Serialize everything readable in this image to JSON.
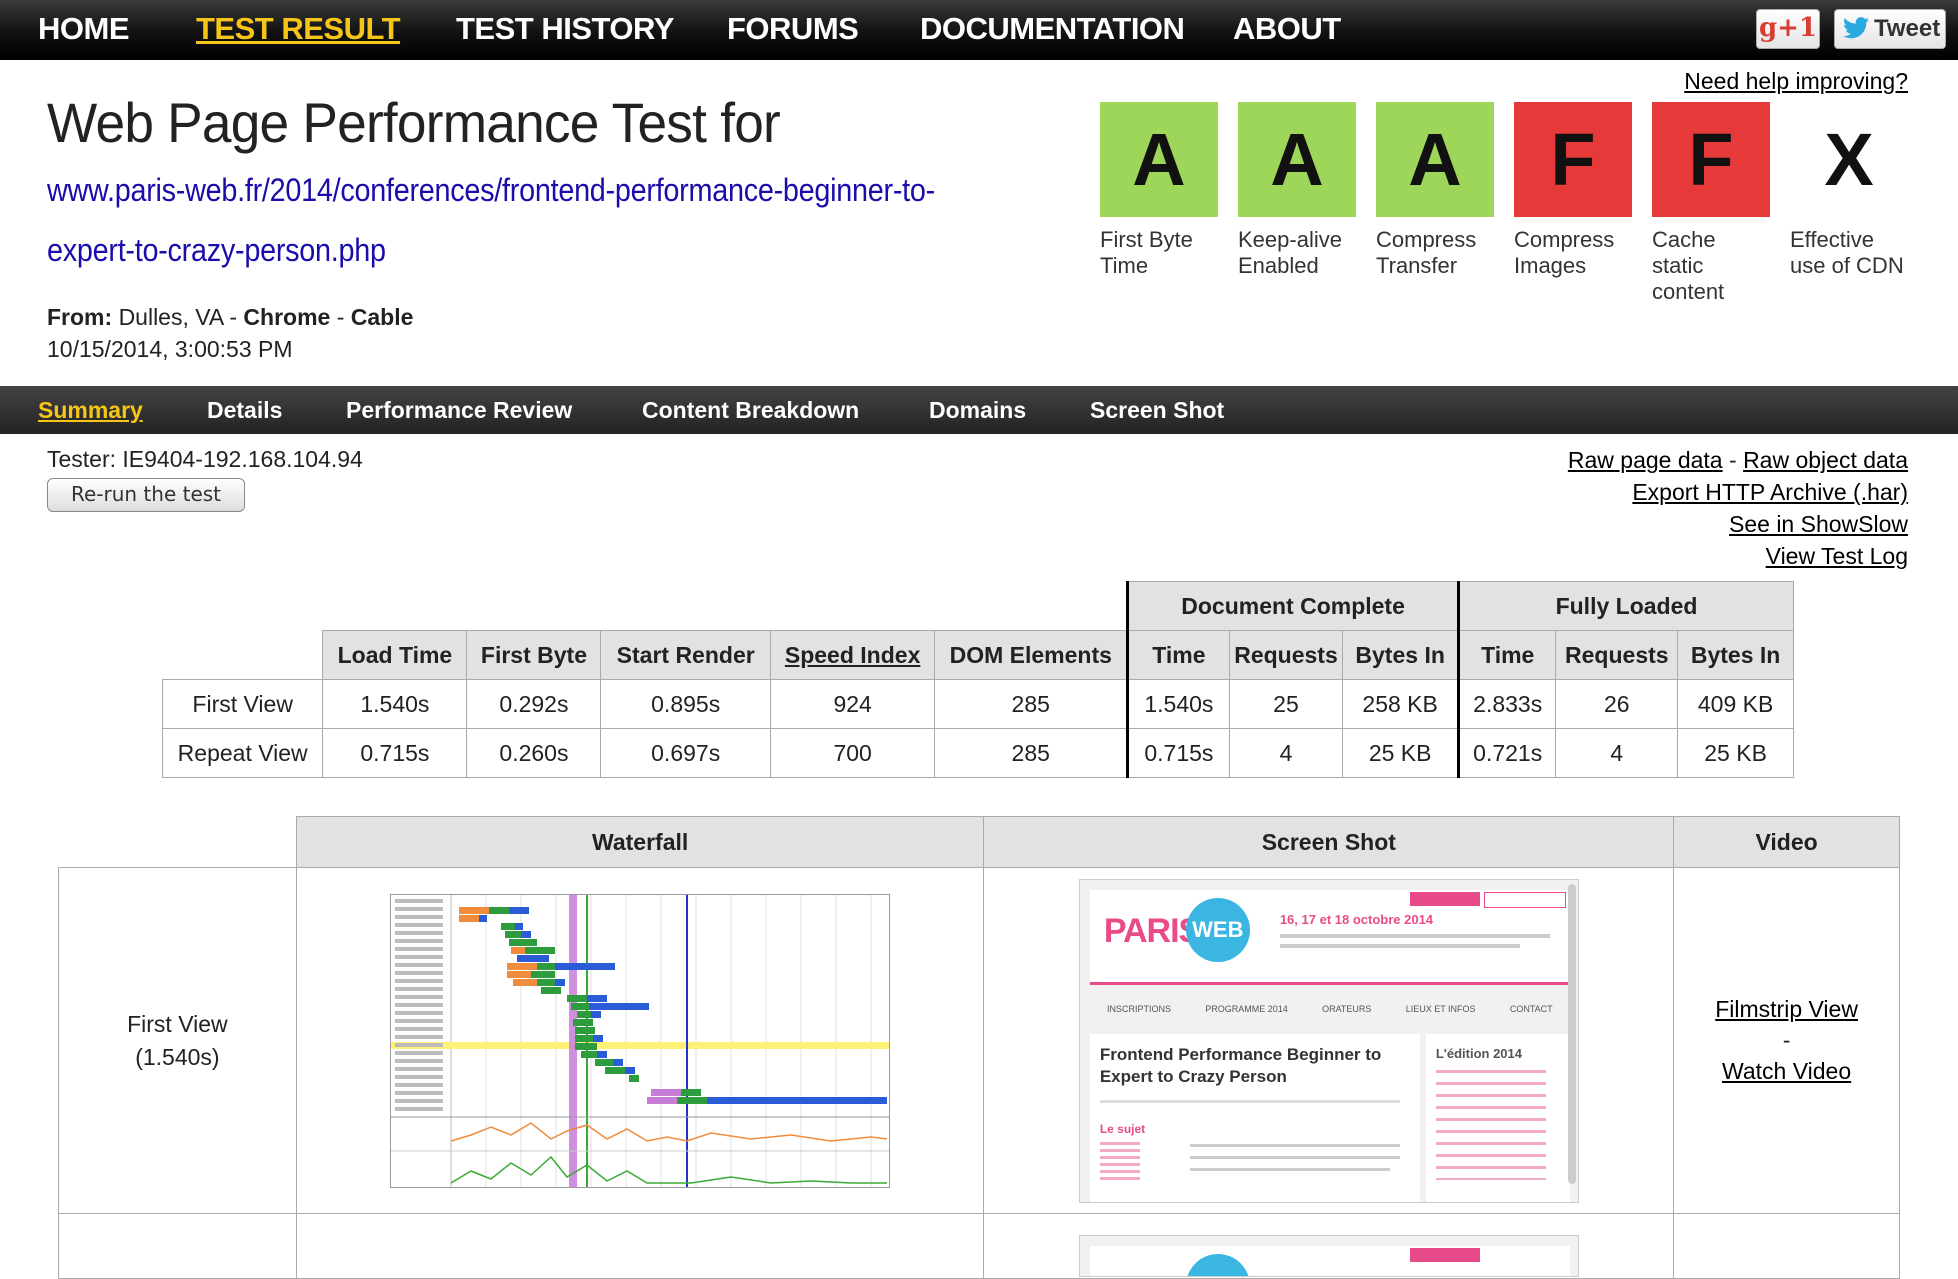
{
  "nav": {
    "items": [
      "HOME",
      "TEST RESULT",
      "TEST HISTORY",
      "FORUMS",
      "DOCUMENTATION",
      "ABOUT"
    ],
    "active_index": 1,
    "gplus": "g+1",
    "tweet": "Tweet"
  },
  "header": {
    "help_link": "Need help improving?",
    "title": "Web Page Performance Test for",
    "url_line1": "www.paris-web.fr/2014/conferences/frontend-performance-beginner-to-",
    "url_line2": "expert-to-crazy-person.php",
    "from_label": "From:",
    "location": "Dulles, VA",
    "sep1": "-",
    "browser": "Chrome",
    "sep2": "-",
    "connection": "Cable",
    "date": "10/15/2014, 3:00:53 PM"
  },
  "grades": [
    {
      "letter": "A",
      "label": "First Byte Time",
      "status": "good"
    },
    {
      "letter": "A",
      "label": "Keep-alive Enabled",
      "status": "good"
    },
    {
      "letter": "A",
      "label": "Compress Transfer",
      "status": "good"
    },
    {
      "letter": "F",
      "label": "Compress Images",
      "status": "bad"
    },
    {
      "letter": "F",
      "label": "Cache static content",
      "status": "bad"
    },
    {
      "letter": "X",
      "label": "Effective use of CDN",
      "status": "none"
    }
  ],
  "subnav": {
    "items": [
      "Summary",
      "Details",
      "Performance Review",
      "Content Breakdown",
      "Domains",
      "Screen Shot"
    ],
    "active_index": 0
  },
  "tester": {
    "label": "Tester: IE9404-192.168.104.94",
    "rerun_button": "Re-run the test"
  },
  "links": {
    "raw_page": "Raw page data",
    "dash": "-",
    "raw_object": "Raw object data",
    "export_har": "Export HTTP Archive (.har)",
    "showslow": "See in ShowSlow",
    "test_log": "View Test Log"
  },
  "results": {
    "group_document": "Document Complete",
    "group_fully": "Fully Loaded",
    "columns": [
      "Load Time",
      "First Byte",
      "Start Render",
      "Speed Index",
      "DOM Elements",
      "Time",
      "Requests",
      "Bytes In",
      "Time",
      "Requests",
      "Bytes In"
    ],
    "rows": [
      {
        "label": "First View",
        "values": [
          "1.540s",
          "0.292s",
          "0.895s",
          "924",
          "285",
          "1.540s",
          "25",
          "258 KB",
          "2.833s",
          "26",
          "409 KB"
        ]
      },
      {
        "label": "Repeat View",
        "values": [
          "0.715s",
          "0.260s",
          "0.697s",
          "700",
          "285",
          "0.715s",
          "4",
          "25 KB",
          "0.721s",
          "4",
          "25 KB"
        ]
      }
    ]
  },
  "media": {
    "headers": [
      "Waterfall",
      "Screen Shot",
      "Video"
    ],
    "first_view_label": "First View",
    "first_view_time": "(1.540s)",
    "filmstrip": "Filmstrip View",
    "dash": "-",
    "watch_video": "Watch Video"
  },
  "screenshot": {
    "logo_text": "PARIS",
    "logo_badge": "WEB",
    "tagline": "16, 17 et 18 octobre 2014",
    "menu": [
      "INSCRIPTIONS",
      "PROGRAMME 2014",
      "ORATEURS",
      "LIEUX ET INFOS",
      "CONTACT"
    ],
    "headline": "Frontend Performance Beginner to Expert to Crazy Person",
    "sidebar_title": "L'édition 2014",
    "section": "Le sujet"
  },
  "colors": {
    "grade_good": "#9ed65a",
    "grade_bad": "#e63939",
    "nav_active": "#f5c518",
    "url": "#1a0dab",
    "header_bg": "#e2e2e2"
  }
}
